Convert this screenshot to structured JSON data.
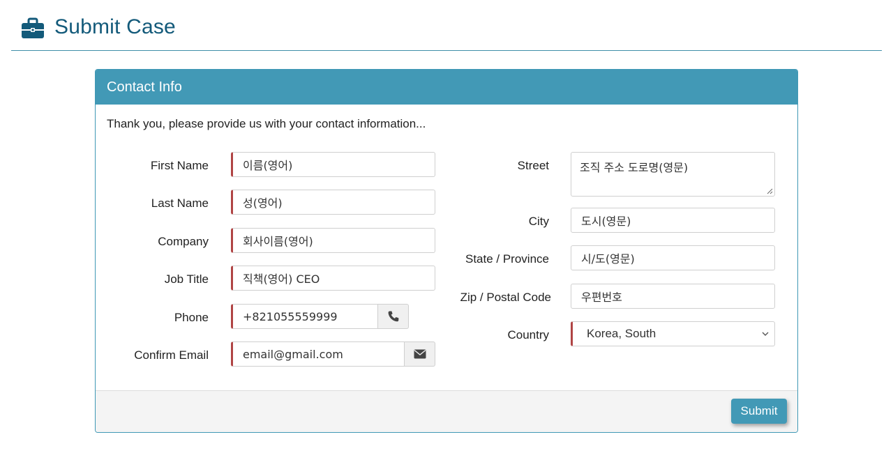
{
  "header": {
    "title": "Submit Case",
    "icon": "briefcase-icon",
    "color": "#135a7a"
  },
  "panel": {
    "title": "Contact Info",
    "intro": "Thank you, please provide us with your contact information...",
    "accent_color": "#4299b6",
    "required_marker_color": "#b04444"
  },
  "left_fields": {
    "first_name": {
      "label": "First Name",
      "value": "이름(영어)"
    },
    "last_name": {
      "label": "Last Name",
      "value": "성(영어)"
    },
    "company": {
      "label": "Company",
      "value": "회사이름(영어)"
    },
    "job_title": {
      "label": "Job Title",
      "value": "직책(영어) CEO"
    },
    "phone": {
      "label": "Phone",
      "value": "+821055559999",
      "icon": "phone-icon"
    },
    "email": {
      "label": "Confirm Email",
      "value": "email@gmail.com",
      "icon": "envelope-icon"
    }
  },
  "right_fields": {
    "street": {
      "label": "Street",
      "value": "조직 주소 도로명(영문)"
    },
    "city": {
      "label": "City",
      "value": "도시(영문)"
    },
    "state": {
      "label": "State / Province",
      "value": "시/도(영문)"
    },
    "zip": {
      "label": "Zip / Postal Code",
      "value": "우편번호"
    },
    "country": {
      "label": "Country",
      "value": "Korea, South"
    }
  },
  "footer": {
    "submit_label": "Submit"
  }
}
